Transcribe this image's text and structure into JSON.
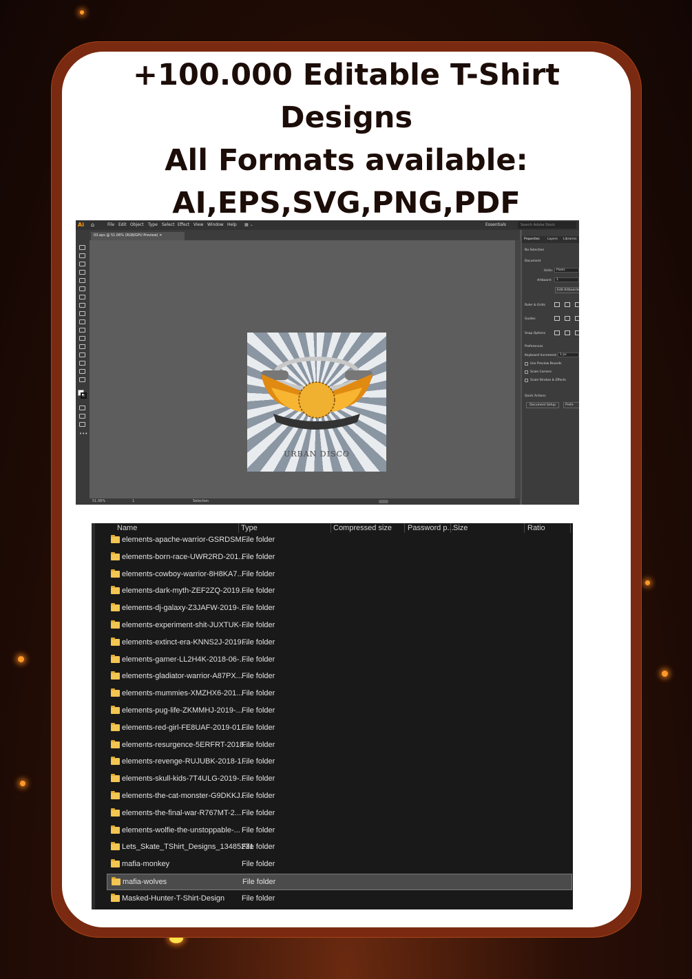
{
  "headline": {
    "line1": "+100.000 Editable T-Shirt",
    "line2": "Designs",
    "line3": "All Formats available:",
    "line4": "AI,EPS,SVG,PNG,PDF"
  },
  "illustrator": {
    "logo": "Ai",
    "menus": [
      "File",
      "Edit",
      "Object",
      "Type",
      "Select",
      "Effect",
      "View",
      "Window",
      "Help"
    ],
    "workspace": "Essentials",
    "search_placeholder": "Search Adobe Stock",
    "doc_tab": "03.eps @ 51.06% (RGB/GPU Preview)",
    "zoom": "51.06%",
    "artboard_num": "1",
    "status_tool": "Selection",
    "artwork_text": "URBAN DISCO",
    "panel": {
      "tabs": [
        "Properties",
        "Layers",
        "Libraries"
      ],
      "no_selection": "No Selection",
      "document": "Document",
      "units_label": "Units:",
      "units_value": "Pixels",
      "artboard_label": "Artboard:",
      "artboard_value": "1",
      "edit_artboards": "Edit Artboards",
      "ruler_grids": "Ruler & Grids",
      "guides": "Guides",
      "snap_options": "Snap Options",
      "preferences": "Preferences",
      "keyboard_increment": "Keyboard Increment:",
      "keyboard_increment_value": "1 px",
      "use_preview_bounds": "Use Preview Bounds",
      "scale_corners": "Scale Corners",
      "scale_strokes": "Scale Strokes & Effects",
      "quick_actions": "Quick Actions",
      "document_setup": "Document Setup",
      "prefs_btn": "Prefe"
    }
  },
  "explorer": {
    "columns": [
      "Name",
      "Type",
      "Compressed size",
      "Password p...",
      "Size",
      "Ratio"
    ],
    "rows": [
      {
        "name": "elements-apache-warrior-GSRDSM...",
        "type": "File folder"
      },
      {
        "name": "elements-born-race-UWR2RD-201...",
        "type": "File folder"
      },
      {
        "name": "elements-cowboy-warrior-8H8KA7...",
        "type": "File folder"
      },
      {
        "name": "elements-dark-myth-ZEF2ZQ-2019...",
        "type": "File folder"
      },
      {
        "name": "elements-dj-galaxy-Z3JAFW-2019-...",
        "type": "File folder"
      },
      {
        "name": "elements-experiment-shit-JUXTUK-...",
        "type": "File folder"
      },
      {
        "name": "elements-extinct-era-KNNS2J-2019...",
        "type": "File folder"
      },
      {
        "name": "elements-gamer-LL2H4K-2018-06-...",
        "type": "File folder"
      },
      {
        "name": "elements-gladiator-warrior-A87PX...",
        "type": "File folder"
      },
      {
        "name": "elements-mummies-XMZHX6-201...",
        "type": "File folder"
      },
      {
        "name": "elements-pug-life-ZKMMHJ-2019-...",
        "type": "File folder"
      },
      {
        "name": "elements-red-girl-FE8UAF-2019-01...",
        "type": "File folder"
      },
      {
        "name": "elements-resurgence-5ERFRT-2018...",
        "type": "File folder"
      },
      {
        "name": "elements-revenge-RUJUBK-2018-1...",
        "type": "File folder"
      },
      {
        "name": "elements-skull-kids-7T4ULG-2019-...",
        "type": "File folder"
      },
      {
        "name": "elements-the-cat-monster-G9DKKJ...",
        "type": "File folder"
      },
      {
        "name": "elements-the-final-war-R767MT-2...",
        "type": "File folder"
      },
      {
        "name": "elements-wolfie-the-unstoppable-...",
        "type": "File folder"
      },
      {
        "name": "Lets_Skate_TShirt_Designs_13485231",
        "type": "File folder"
      },
      {
        "name": "mafia-monkey",
        "type": "File folder"
      },
      {
        "name": "mafia-wolves",
        "type": "File folder",
        "selected": true
      },
      {
        "name": "Masked-Hunter-T-Shirt-Design",
        "type": "File folder"
      }
    ]
  },
  "colors": {
    "frame": "#7a2a10",
    "headline": "#1c0d08",
    "folder": "#f3c552",
    "explorer_bg": "#191919"
  }
}
